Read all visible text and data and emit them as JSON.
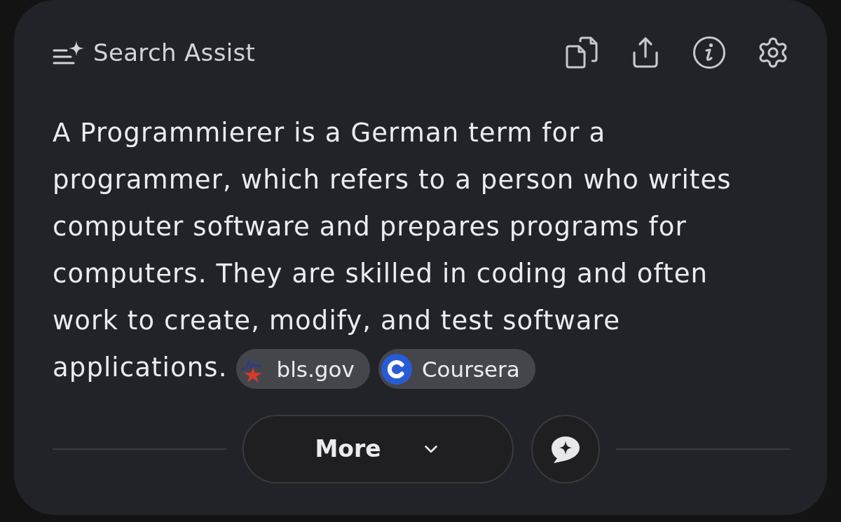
{
  "header": {
    "title": "Search Assist"
  },
  "answer": {
    "text": "A Programmierer is a German term for a programmer, which refers to a person who writes computer software and prepares programs for computers. They are skilled in coding and often work to create, modify, and test software applications.",
    "sources": [
      {
        "kind": "bls",
        "label": "bls.gov"
      },
      {
        "kind": "coursera",
        "label": "Coursera"
      }
    ]
  },
  "footer": {
    "more_button": {
      "label": "More",
      "expanded": false
    }
  }
}
